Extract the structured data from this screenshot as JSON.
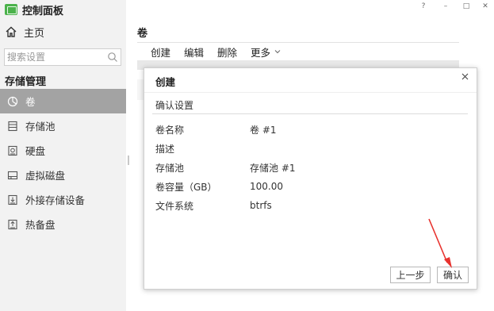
{
  "app": {
    "title": "控制面板"
  },
  "window": {
    "help": "?",
    "minimize": "–",
    "maximize": "□",
    "close": "✕"
  },
  "sidebar": {
    "home_label": "主页",
    "search_placeholder": "搜索设置",
    "group_title": "存储管理",
    "items": [
      {
        "label": "卷",
        "icon": "pie-chart-icon",
        "active": true
      },
      {
        "label": "存储池",
        "icon": "storage-pool-icon",
        "active": false
      },
      {
        "label": "硬盘",
        "icon": "hard-disk-icon",
        "active": false
      },
      {
        "label": "虚拟磁盘",
        "icon": "virtual-disk-icon",
        "active": false
      },
      {
        "label": "外接存储设备",
        "icon": "external-storage-icon",
        "active": false
      },
      {
        "label": "热备盘",
        "icon": "hot-spare-icon",
        "active": false
      }
    ]
  },
  "main": {
    "title": "卷",
    "toolbar": {
      "create": "创建",
      "edit": "编辑",
      "delete": "删除",
      "more": "更多"
    }
  },
  "dialog": {
    "title": "创建",
    "section_title": "确认设置",
    "rows": [
      {
        "key": "卷名称",
        "value": "卷 #1"
      },
      {
        "key": "描述",
        "value": ""
      },
      {
        "key": "存储池",
        "value": "存储池 #1"
      },
      {
        "key": "卷容量（GB）",
        "value": "100.00"
      },
      {
        "key": "文件系统",
        "value": "btrfs"
      }
    ],
    "prev_button": "上一步",
    "confirm_button": "确认"
  },
  "colors": {
    "sidebar_bg": "#f2f2f2",
    "active_item_bg": "#a3a3a3",
    "logo_green": "#4bb24b",
    "annotation_arrow": "#e8322e"
  }
}
